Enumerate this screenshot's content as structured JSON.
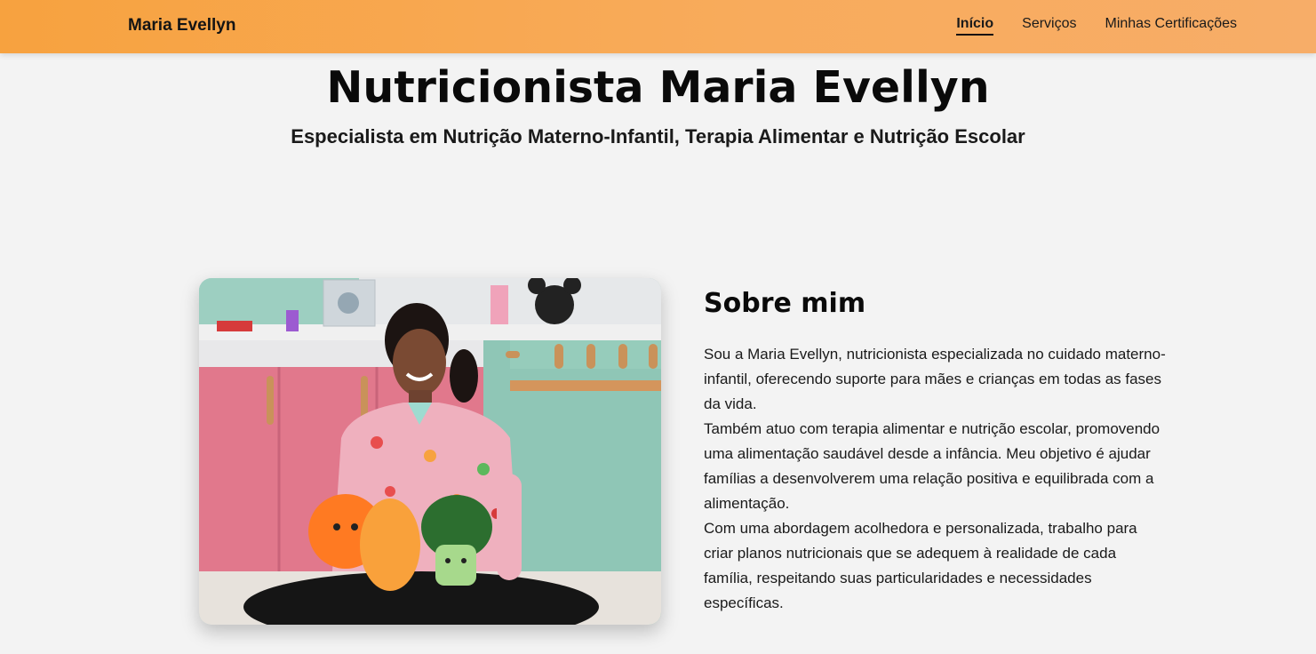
{
  "navbar": {
    "brand": "Maria Evellyn",
    "links": [
      {
        "label": "Início",
        "active": true
      },
      {
        "label": "Serviços",
        "active": false
      },
      {
        "label": "Minhas Certificações",
        "active": false
      }
    ],
    "gradient_colors": [
      "#f7a23f",
      "#f7ad68"
    ]
  },
  "hero": {
    "title": "Nutricionista Maria Evellyn",
    "subtitle": "Especialista em Nutrição Materno-Infantil, Terapia Alimentar e Nutrição Escolar"
  },
  "about": {
    "title": "Sobre mim",
    "paragraphs": [
      "Sou a Maria Evellyn, nutricionista especializada no cuidado materno-infantil, oferecendo suporte para mães e crianças em todas as fases da vida.",
      "Também atuo com terapia alimentar e nutrição escolar, promovendo uma alimentação saudável desde a infância. Meu objetivo é ajudar famílias a desenvolverem uma relação positiva e equilibrada com a alimentação.",
      "Com uma abordagem acolhedora e personalizada, trabalho para criar planos nutricionais que se adequem à realidade de cada família, respeitando suas particularidades e necessidades específicas."
    ]
  },
  "colors": {
    "page_background": "#f3f3f3",
    "accent_orange": "#f7a23f"
  }
}
